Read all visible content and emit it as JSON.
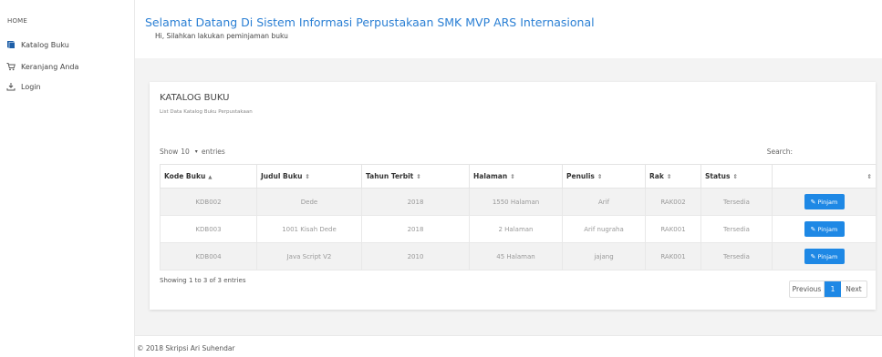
{
  "sidebar": {
    "heading": "HOME",
    "items": [
      {
        "label": "Katalog Buku",
        "icon": "book-icon"
      },
      {
        "label": "Keranjang Anda",
        "icon": "cart-icon"
      },
      {
        "label": "Login",
        "icon": "download-icon"
      }
    ]
  },
  "header": {
    "title": "Selamat Datang Di Sistem Informasi Perpustakaan SMK MVP ARS Internasional",
    "subtitle": "Hi, Silahkan lakukan peminjaman buku"
  },
  "card": {
    "title": "KATALOG BUKU",
    "subtitle": "List Data Katalog Buku Perpustakaan",
    "show_prefix": "Show",
    "show_value": "10",
    "show_suffix": "entries",
    "search_label": "Search:",
    "search_value": ""
  },
  "table": {
    "columns": [
      "Kode Buku",
      "Judul Buku",
      "Tahun Terbit",
      "Halaman",
      "Penulis",
      "Rak",
      "Status",
      ""
    ],
    "sort_asc_glyph": "▲",
    "sort_glyph": "⇕",
    "rows": [
      {
        "kode": "KDB002",
        "judul": "Dede",
        "tahun": "2018",
        "halaman": "1550 Halaman",
        "penulis": "Arif",
        "rak": "RAK002",
        "status": "Tersedia",
        "action": "Pinjam"
      },
      {
        "kode": "KDB003",
        "judul": "1001 Kisah Dede",
        "tahun": "2018",
        "halaman": "2 Halaman",
        "penulis": "Arif nugraha",
        "rak": "RAK001",
        "status": "Tersedia",
        "action": "Pinjam"
      },
      {
        "kode": "KDB004",
        "judul": "Java Script V2",
        "tahun": "2010",
        "halaman": "45 Halaman",
        "penulis": "jajang",
        "rak": "RAK001",
        "status": "Tersedia",
        "action": "Pinjam"
      }
    ]
  },
  "footer_table": {
    "showing": "Showing 1 to 3 of 3 entries",
    "previous": "Previous",
    "page": "1",
    "next": "Next"
  },
  "footer": {
    "copyright": "© 2018 Skripsi Ari Suhendar"
  },
  "colors": {
    "accent": "#1e88e5",
    "title": "#2a7fd4",
    "main_bg": "#f3f3f3"
  }
}
